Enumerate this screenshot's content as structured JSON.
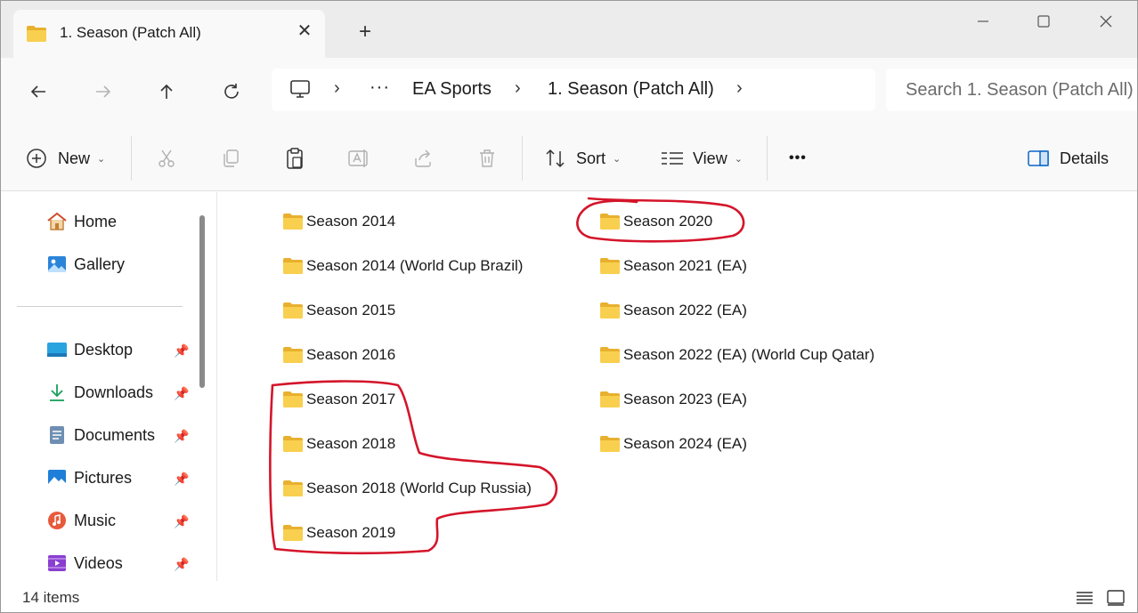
{
  "window": {
    "tab_title": "1. Season (Patch All)",
    "close_tab_glyph": "✕",
    "new_tab_glyph": "+"
  },
  "address": {
    "crumbs": [
      "EA Sports",
      "1. Season (Patch All)"
    ],
    "ellipsis": "···",
    "separator": "›",
    "search_placeholder": "Search 1. Season (Patch All)"
  },
  "commands": {
    "new_label": "New",
    "sort_label": "Sort",
    "view_label": "View",
    "more_label": "•••",
    "details_label": "Details",
    "chevron": "⌄"
  },
  "sidebar": {
    "top_items": [
      {
        "label": "Home",
        "icon": "home-icon"
      },
      {
        "label": "Gallery",
        "icon": "gallery-icon"
      }
    ],
    "quick_access": [
      {
        "label": "Desktop",
        "icon": "desktop-icon",
        "pinned": true
      },
      {
        "label": "Downloads",
        "icon": "downloads-icon",
        "pinned": true
      },
      {
        "label": "Documents",
        "icon": "documents-icon",
        "pinned": true
      },
      {
        "label": "Pictures",
        "icon": "pictures-icon",
        "pinned": true
      },
      {
        "label": "Music",
        "icon": "music-icon",
        "pinned": true
      },
      {
        "label": "Videos",
        "icon": "videos-icon",
        "pinned": true
      }
    ],
    "pin_glyph": "📌"
  },
  "folders": {
    "column_1": [
      "Season 2014",
      "Season 2014 (World Cup Brazil)",
      "Season 2015",
      "Season 2016",
      "Season 2017",
      "Season 2018",
      "Season 2018 (World Cup Russia)",
      "Season 2019"
    ],
    "column_2": [
      "Season 2020",
      "Season 2021 (EA)",
      "Season 2022 (EA)",
      "Season 2022 (EA) (World Cup Qatar)",
      "Season 2023 (EA)",
      "Season 2024 (EA)"
    ]
  },
  "status": {
    "item_count": "14 items"
  },
  "colors": {
    "folder_yellow": "#f8c93e",
    "annotation_red": "#d4152a",
    "accent_blue": "#0a64c8"
  }
}
